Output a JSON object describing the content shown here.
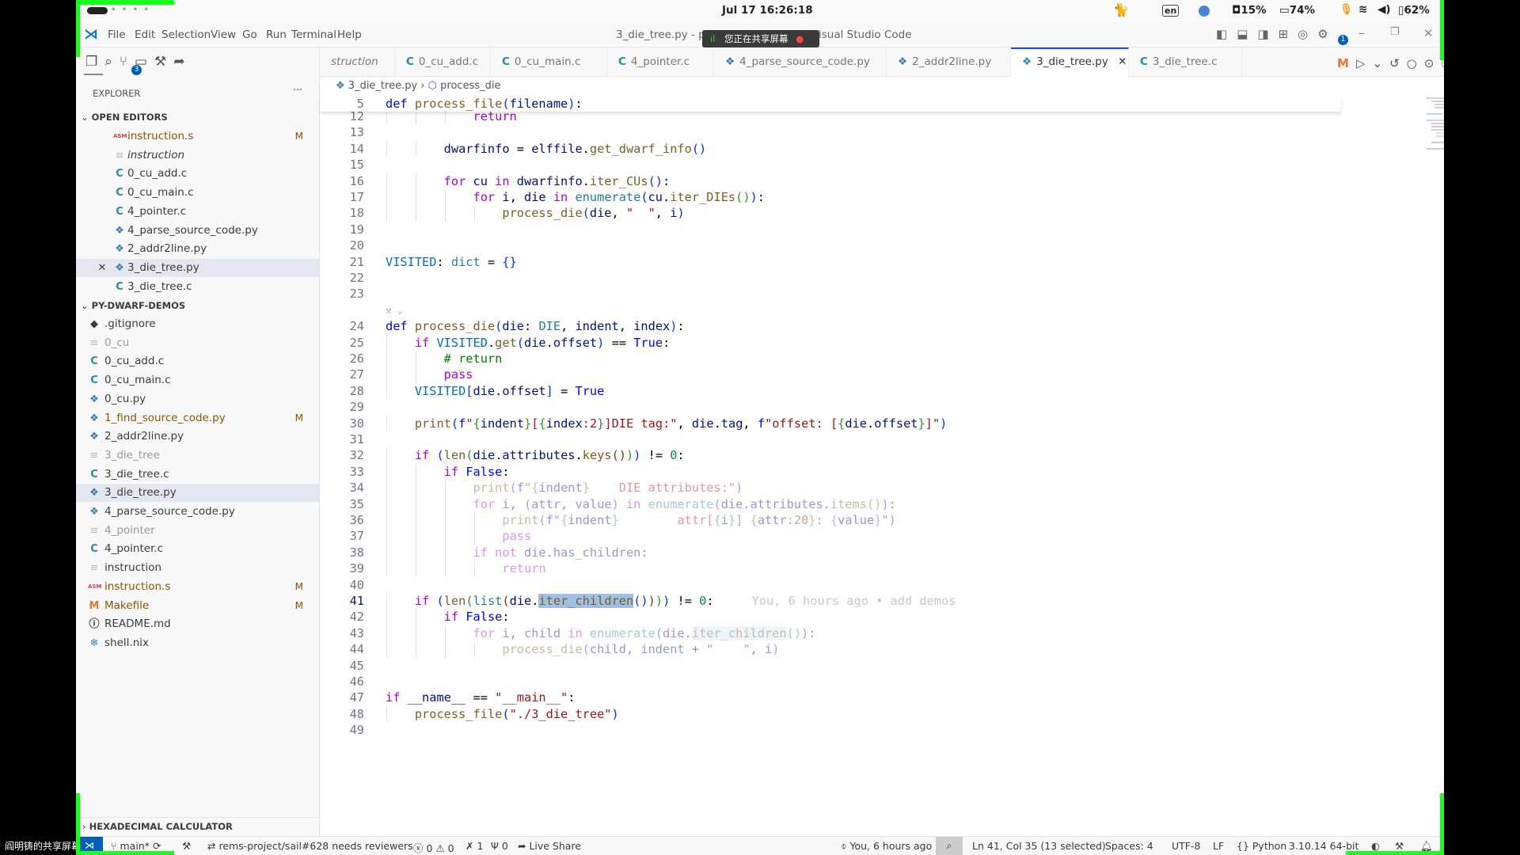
{
  "system": {
    "clock": "Jul 17  16:26:18",
    "cpu": "15%",
    "memory": "74%",
    "battery": "62%",
    "keyboard": "en"
  },
  "window": {
    "title_left": "3_die_tree.py - p",
    "title_right": "isual Studio Code",
    "share_notice": "您正在共享屏幕",
    "share_owner": "阎明铸的共享屏幕"
  },
  "menu": [
    "File",
    "Edit",
    "Selection",
    "View",
    "Go",
    "Run",
    "Terminal",
    "Help"
  ],
  "activity": {
    "scm_badge": "3",
    "settings_badge": "1"
  },
  "tabs": [
    {
      "label": "struction",
      "type": "txt"
    },
    {
      "label": "0_cu_add.c",
      "type": "c"
    },
    {
      "label": "0_cu_main.c",
      "type": "c"
    },
    {
      "label": "4_pointer.c",
      "type": "c"
    },
    {
      "label": "4_parse_source_code.py",
      "type": "py"
    },
    {
      "label": "2_addr2line.py",
      "type": "py"
    },
    {
      "label": "3_die_tree.py",
      "type": "py",
      "active": true
    },
    {
      "label": "3_die_tree.c",
      "type": "c"
    }
  ],
  "editor_actions": {
    "git_mark": "M"
  },
  "sidebar": {
    "title": "EXPLORER",
    "open_editors_label": "OPEN EDITORS",
    "open_editors": [
      {
        "label": "instruction.s",
        "icon": "asm",
        "badge": "M",
        "modified": true
      },
      {
        "label": "instruction",
        "icon": "txt",
        "italic": true
      },
      {
        "label": "0_cu_add.c",
        "icon": "c"
      },
      {
        "label": "0_cu_main.c",
        "icon": "c"
      },
      {
        "label": "4_pointer.c",
        "icon": "c"
      },
      {
        "label": "4_parse_source_code.py",
        "icon": "py"
      },
      {
        "label": "2_addr2line.py",
        "icon": "py"
      },
      {
        "label": "3_die_tree.py",
        "icon": "py",
        "selected": true,
        "closable": true
      },
      {
        "label": "3_die_tree.c",
        "icon": "c"
      }
    ],
    "folder_label": "PY-DWARF-DEMOS",
    "files": [
      {
        "label": ".gitignore",
        "icon": "git"
      },
      {
        "label": "0_cu",
        "icon": "txt",
        "dim": true
      },
      {
        "label": "0_cu_add.c",
        "icon": "c"
      },
      {
        "label": "0_cu_main.c",
        "icon": "c"
      },
      {
        "label": "0_cu.py",
        "icon": "py"
      },
      {
        "label": "1_find_source_code.py",
        "icon": "py",
        "badge": "M",
        "modified": true
      },
      {
        "label": "2_addr2line.py",
        "icon": "py"
      },
      {
        "label": "3_die_tree",
        "icon": "txt",
        "dim": true
      },
      {
        "label": "3_die_tree.c",
        "icon": "c"
      },
      {
        "label": "3_die_tree.py",
        "icon": "py",
        "selected": true
      },
      {
        "label": "4_parse_source_code.py",
        "icon": "py"
      },
      {
        "label": "4_pointer",
        "icon": "txt",
        "dim": true
      },
      {
        "label": "4_pointer.c",
        "icon": "c"
      },
      {
        "label": "instruction",
        "icon": "txt"
      },
      {
        "label": "instruction.s",
        "icon": "asm",
        "badge": "M",
        "modified": true
      },
      {
        "label": "Makefile",
        "icon": "make",
        "badge": "M",
        "modified": true
      },
      {
        "label": "README.md",
        "icon": "info"
      },
      {
        "label": "shell.nix",
        "icon": "nix"
      }
    ],
    "bottom_panel": "HEXADECIMAL CALCULATOR"
  },
  "breadcrumb": {
    "file": "3_die_tree.py",
    "symbol": "process_die"
  },
  "sticky": {
    "n": "5",
    "tokens": [
      [
        "kw",
        "def "
      ],
      [
        "fn",
        "process_file"
      ],
      [
        "b1",
        "("
      ],
      [
        "var",
        "filename"
      ],
      [
        "b1",
        ")"
      ],
      [
        "p",
        ":"
      ]
    ]
  },
  "code": [
    {
      "n": "12",
      "indent": 3,
      "tokens": [
        [
          "ctl",
          "return"
        ]
      ]
    },
    {
      "n": "13",
      "indent": 0,
      "tokens": []
    },
    {
      "n": "14",
      "indent": 2,
      "tokens": [
        [
          "var",
          "dwarfinfo"
        ],
        [
          "p",
          " = "
        ],
        [
          "var",
          "elffile"
        ],
        [
          "p",
          "."
        ],
        [
          "fn",
          "get_dwarf_info"
        ],
        [
          "b1",
          "()"
        ]
      ]
    },
    {
      "n": "15",
      "indent": 0,
      "tokens": []
    },
    {
      "n": "16",
      "indent": 2,
      "tokens": [
        [
          "ctl",
          "for "
        ],
        [
          "var",
          "cu "
        ],
        [
          "ctl",
          "in "
        ],
        [
          "var",
          "dwarfinfo"
        ],
        [
          "p",
          "."
        ],
        [
          "fn",
          "iter_CUs"
        ],
        [
          "b1",
          "()"
        ],
        [
          "p",
          ":"
        ]
      ]
    },
    {
      "n": "17",
      "indent": 3,
      "tokens": [
        [
          "ctl",
          "for "
        ],
        [
          "var",
          "i"
        ],
        [
          "p",
          ", "
        ],
        [
          "var",
          "die "
        ],
        [
          "ctl",
          "in "
        ],
        [
          "ty",
          "enumerate"
        ],
        [
          "b1",
          "("
        ],
        [
          "var",
          "cu"
        ],
        [
          "p",
          "."
        ],
        [
          "fn",
          "iter_DIEs"
        ],
        [
          "b2",
          "()"
        ],
        [
          "b1",
          ")"
        ],
        [
          "p",
          ":"
        ]
      ]
    },
    {
      "n": "18",
      "indent": 4,
      "tokens": [
        [
          "fn",
          "process_die"
        ],
        [
          "b1",
          "("
        ],
        [
          "var",
          "die"
        ],
        [
          "p",
          ", "
        ],
        [
          "str",
          "\"  \""
        ],
        [
          "p",
          ", "
        ],
        [
          "var",
          "i"
        ],
        [
          "b1",
          ")"
        ]
      ]
    },
    {
      "n": "19",
      "indent": 0,
      "tokens": []
    },
    {
      "n": "20",
      "indent": 0,
      "tokens": []
    },
    {
      "n": "21",
      "indent": 0,
      "tokens": [
        [
          "cst",
          "VISITED"
        ],
        [
          "p",
          ": "
        ],
        [
          "ty",
          "dict"
        ],
        [
          "p",
          " = "
        ],
        [
          "b1",
          "{}"
        ]
      ]
    },
    {
      "n": "22",
      "indent": 0,
      "tokens": []
    },
    {
      "n": "23",
      "indent": 0,
      "tokens": []
    },
    {
      "n": "",
      "indent": 0,
      "codelens": true,
      "tokens": []
    },
    {
      "n": "24",
      "indent": 0,
      "tokens": [
        [
          "kw",
          "def "
        ],
        [
          "fn",
          "process_die"
        ],
        [
          "b1",
          "("
        ],
        [
          "var",
          "die"
        ],
        [
          "p",
          ": "
        ],
        [
          "ty",
          "DIE"
        ],
        [
          "p",
          ", "
        ],
        [
          "var",
          "indent"
        ],
        [
          "p",
          ", "
        ],
        [
          "var",
          "index"
        ],
        [
          "b1",
          ")"
        ],
        [
          "p",
          ":"
        ]
      ]
    },
    {
      "n": "25",
      "indent": 1,
      "tokens": [
        [
          "ctl",
          "if "
        ],
        [
          "cst",
          "VISITED"
        ],
        [
          "p",
          "."
        ],
        [
          "fn",
          "get"
        ],
        [
          "b1",
          "("
        ],
        [
          "var",
          "die"
        ],
        [
          "p",
          "."
        ],
        [
          "var",
          "offset"
        ],
        [
          "b1",
          ")"
        ],
        [
          "p",
          " == "
        ],
        [
          "kw",
          "True"
        ],
        [
          "p",
          ":"
        ]
      ]
    },
    {
      "n": "26",
      "indent": 2,
      "tokens": [
        [
          "com",
          "# return"
        ]
      ]
    },
    {
      "n": "27",
      "indent": 2,
      "tokens": [
        [
          "ctl",
          "pass"
        ]
      ]
    },
    {
      "n": "28",
      "indent": 1,
      "tokens": [
        [
          "cst",
          "VISITED"
        ],
        [
          "b1",
          "["
        ],
        [
          "var",
          "die"
        ],
        [
          "p",
          "."
        ],
        [
          "var",
          "offset"
        ],
        [
          "b1",
          "]"
        ],
        [
          "p",
          " = "
        ],
        [
          "kw",
          "True"
        ]
      ]
    },
    {
      "n": "29",
      "indent": 0,
      "tokens": []
    },
    {
      "n": "30",
      "indent": 1,
      "tokens": [
        [
          "fn",
          "print"
        ],
        [
          "b1",
          "("
        ],
        [
          "kw",
          "f"
        ],
        [
          "str",
          "\""
        ],
        [
          "b2",
          "{"
        ],
        [
          "var",
          "indent"
        ],
        [
          "b2",
          "}"
        ],
        [
          "str",
          "["
        ],
        [
          "b2",
          "{"
        ],
        [
          "var",
          "index"
        ],
        [
          "str",
          ":2"
        ],
        [
          "b2",
          "}"
        ],
        [
          "str",
          "]DIE tag:\""
        ],
        [
          "p",
          ", "
        ],
        [
          "var",
          "die"
        ],
        [
          "p",
          "."
        ],
        [
          "var",
          "tag"
        ],
        [
          "p",
          ", "
        ],
        [
          "kw",
          "f"
        ],
        [
          "str",
          "\"offset: ["
        ],
        [
          "b2",
          "{"
        ],
        [
          "var",
          "die"
        ],
        [
          "p",
          "."
        ],
        [
          "var",
          "offset"
        ],
        [
          "b2",
          "}"
        ],
        [
          "str",
          "]\""
        ],
        [
          "b1",
          ")"
        ]
      ]
    },
    {
      "n": "31",
      "indent": 0,
      "tokens": []
    },
    {
      "n": "32",
      "indent": 1,
      "tokens": [
        [
          "ctl",
          "if "
        ],
        [
          "b1",
          "("
        ],
        [
          "fn",
          "len"
        ],
        [
          "b2",
          "("
        ],
        [
          "var",
          "die"
        ],
        [
          "p",
          "."
        ],
        [
          "var",
          "attributes"
        ],
        [
          "p",
          "."
        ],
        [
          "fn",
          "keys"
        ],
        [
          "b3",
          "()"
        ],
        [
          "b2",
          ")"
        ],
        [
          "b1",
          ")"
        ],
        [
          "p",
          " != "
        ],
        [
          "num",
          "0"
        ],
        [
          "p",
          ":"
        ]
      ]
    },
    {
      "n": "33",
      "indent": 2,
      "tokens": [
        [
          "ctl",
          "if "
        ],
        [
          "kw",
          "False"
        ],
        [
          "p",
          ":"
        ]
      ]
    },
    {
      "n": "34",
      "indent": 3,
      "faded": true,
      "tokens": [
        [
          "fn",
          "print"
        ],
        [
          "b1",
          "("
        ],
        [
          "kw",
          "f"
        ],
        [
          "str",
          "\""
        ],
        [
          "b2",
          "{"
        ],
        [
          "var",
          "indent"
        ],
        [
          "b2",
          "}"
        ],
        [
          "str",
          "    DIE attributes:\""
        ],
        [
          "b1",
          ")"
        ]
      ]
    },
    {
      "n": "35",
      "indent": 3,
      "faded": true,
      "tokens": [
        [
          "ctl",
          "for "
        ],
        [
          "var",
          "i"
        ],
        [
          "p",
          ", "
        ],
        [
          "b1",
          "("
        ],
        [
          "var",
          "attr"
        ],
        [
          "p",
          ", "
        ],
        [
          "var",
          "value"
        ],
        [
          "b1",
          ") "
        ],
        [
          "ctl",
          "in "
        ],
        [
          "ty",
          "enumerate"
        ],
        [
          "b1",
          "("
        ],
        [
          "var",
          "die"
        ],
        [
          "p",
          "."
        ],
        [
          "var",
          "attributes"
        ],
        [
          "p",
          "."
        ],
        [
          "fn",
          "items"
        ],
        [
          "b2",
          "()"
        ],
        [
          "b1",
          ")"
        ],
        [
          "p",
          ":"
        ]
      ]
    },
    {
      "n": "36",
      "indent": 4,
      "faded": true,
      "tokens": [
        [
          "fn",
          "print"
        ],
        [
          "b1",
          "("
        ],
        [
          "kw",
          "f"
        ],
        [
          "str",
          "\""
        ],
        [
          "b2",
          "{"
        ],
        [
          "var",
          "indent"
        ],
        [
          "b2",
          "}"
        ],
        [
          "str",
          "        attr["
        ],
        [
          "b2",
          "{"
        ],
        [
          "var",
          "i"
        ],
        [
          "b2",
          "}"
        ],
        [
          "str",
          "] "
        ],
        [
          "b2",
          "{"
        ],
        [
          "var",
          "attr"
        ],
        [
          "str",
          ":20"
        ],
        [
          "b2",
          "}"
        ],
        [
          "str",
          ": "
        ],
        [
          "b2",
          "{"
        ],
        [
          "var",
          "value"
        ],
        [
          "b2",
          "}"
        ],
        [
          "str",
          "\""
        ],
        [
          "b1",
          ")"
        ]
      ]
    },
    {
      "n": "37",
      "indent": 4,
      "faded": true,
      "tokens": [
        [
          "ctl",
          "pass"
        ]
      ]
    },
    {
      "n": "38",
      "indent": 3,
      "faded": true,
      "tokens": [
        [
          "ctl",
          "if not "
        ],
        [
          "var",
          "die"
        ],
        [
          "p",
          "."
        ],
        [
          "var",
          "has_children"
        ],
        [
          "p",
          ":"
        ]
      ]
    },
    {
      "n": "39",
      "indent": 4,
      "faded": true,
      "tokens": [
        [
          "ctl",
          "return"
        ]
      ]
    },
    {
      "n": "40",
      "indent": 0,
      "tokens": []
    },
    {
      "n": "41",
      "indent": 1,
      "current": true,
      "tokens": [
        [
          "ctl",
          "if "
        ],
        [
          "b1",
          "("
        ],
        [
          "fn",
          "len"
        ],
        [
          "b2",
          "("
        ],
        [
          "ty",
          "list"
        ],
        [
          "b3",
          "("
        ],
        [
          "var",
          "die"
        ],
        [
          "p",
          "."
        ],
        [
          "fn sel",
          "iter_children"
        ],
        [
          "b1",
          "()"
        ],
        [
          "b3",
          ")"
        ],
        [
          "b2",
          ")"
        ],
        [
          "b1",
          ")"
        ],
        [
          "p",
          " != "
        ],
        [
          "num",
          "0"
        ],
        [
          "p",
          ":"
        ]
      ],
      "blame": "You, 6 hours ago • add demos"
    },
    {
      "n": "42",
      "indent": 2,
      "tokens": [
        [
          "ctl",
          "if "
        ],
        [
          "kw",
          "False"
        ],
        [
          "p",
          ":"
        ]
      ]
    },
    {
      "n": "43",
      "indent": 3,
      "faded": true,
      "tokens": [
        [
          "ctl",
          "for "
        ],
        [
          "var",
          "i"
        ],
        [
          "p",
          ", "
        ],
        [
          "var",
          "child "
        ],
        [
          "ctl",
          "in "
        ],
        [
          "ty",
          "enumerate"
        ],
        [
          "b1",
          "("
        ],
        [
          "var",
          "die"
        ],
        [
          "p",
          "."
        ],
        [
          "fn sel2",
          "iter_children"
        ],
        [
          "b2",
          "()"
        ],
        [
          "b1",
          ")"
        ],
        [
          "p",
          ":"
        ]
      ]
    },
    {
      "n": "44",
      "indent": 4,
      "faded": true,
      "tokens": [
        [
          "fn",
          "process_die"
        ],
        [
          "b1",
          "("
        ],
        [
          "var",
          "child"
        ],
        [
          "p",
          ", "
        ],
        [
          "var",
          "indent"
        ],
        [
          "p",
          " + "
        ],
        [
          "str",
          "\"    \""
        ],
        [
          "p",
          ", "
        ],
        [
          "var",
          "i"
        ],
        [
          "b1",
          ")"
        ]
      ]
    },
    {
      "n": "45",
      "indent": 0,
      "tokens": []
    },
    {
      "n": "46",
      "indent": 0,
      "tokens": []
    },
    {
      "n": "47",
      "indent": 0,
      "tokens": [
        [
          "ctl",
          "if "
        ],
        [
          "var",
          "__name__"
        ],
        [
          "p",
          " == "
        ],
        [
          "str",
          "\"__main__\""
        ],
        [
          "p",
          ":"
        ]
      ]
    },
    {
      "n": "48",
      "indent": 1,
      "tokens": [
        [
          "fn",
          "process_file"
        ],
        [
          "b1",
          "("
        ],
        [
          "str",
          "\"./3_die_tree\""
        ],
        [
          "b1",
          ")"
        ]
      ]
    },
    {
      "n": "49",
      "indent": 0,
      "tokens": []
    }
  ],
  "statusbar": {
    "branch": "main*",
    "pr": "rems-project/sail#628 needs reviewers",
    "errors": "0",
    "warnings": "0",
    "ports": "1",
    "remote_count": "0",
    "live_share": "Live Share",
    "blame": "You, 6 hours ago",
    "cursor": "Ln 41, Col 35 (13 selected)",
    "spaces": "Spaces: 4",
    "encoding": "UTF-8",
    "eol": "LF",
    "language": "Python",
    "interpreter": "3.10.14 64-bit"
  },
  "colors": {
    "accent": "#005fb8",
    "modified": "#895503",
    "selection": "#9fc0e3"
  }
}
